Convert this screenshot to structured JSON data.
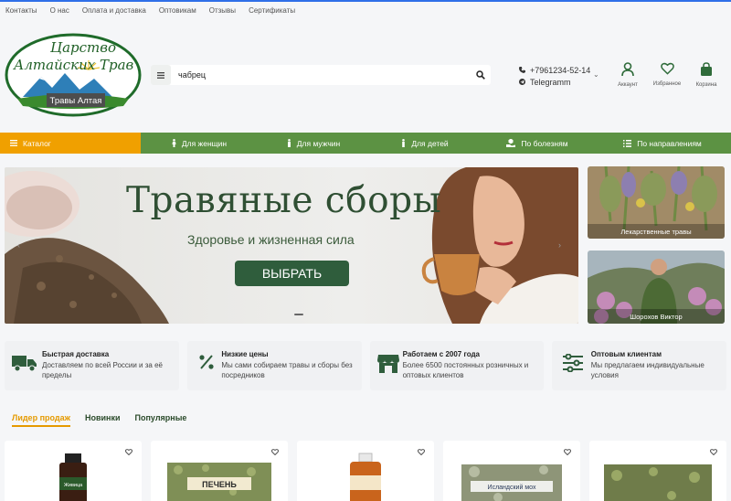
{
  "topbar": {
    "links": [
      "Контакты",
      "О нас",
      "Оплата и доставка",
      "Оптовикам",
      "Отзывы",
      "Сертификаты"
    ]
  },
  "logo": {
    "line1": "Царство",
    "line2": "Алтайских Трав",
    "badge": "Травы Алтая"
  },
  "search": {
    "value": "чабрец"
  },
  "contacts": {
    "phone": "+7961234-52-14",
    "telegram": "Telegramm"
  },
  "header_icons": {
    "account": "Аккаунт",
    "favorites": "Избранное",
    "cart": "Корзина"
  },
  "nav": {
    "catalog": "Каталог",
    "items": [
      "Для женщин",
      "Для мужчин",
      "Для детей",
      "По болезням",
      "По направлениям"
    ]
  },
  "banner": {
    "title": "Травяные сборы",
    "subtitle": "Здоровье и жизненная сила",
    "cta": "ВЫБРАТЬ"
  },
  "side_banners": [
    {
      "caption": "Лекарственные травы"
    },
    {
      "caption": "Шорохов Виктор"
    }
  ],
  "features": [
    {
      "title": "Быстрая доставка",
      "desc": "Доставляем по всей России и за её пределы"
    },
    {
      "title": "Низкие цены",
      "desc": "Мы сами собираем травы и сборы без посредников"
    },
    {
      "title": "Работаем с 2007 года",
      "desc": "Более 6500 постоянных розничных и оптовых клиентов"
    },
    {
      "title": "Оптовым клиентам",
      "desc": "Мы предлагаем индивидуальные условия"
    }
  ],
  "tabs": [
    "Лидер продаж",
    "Новинки",
    "Популярные"
  ],
  "product_labels": [
    "Живица",
    "ПЕЧЕНЬ",
    "Исландский мох"
  ],
  "colors": {
    "green_nav": "#5c9243",
    "orange": "#f0a000",
    "dark_green": "#2f5d3c"
  }
}
